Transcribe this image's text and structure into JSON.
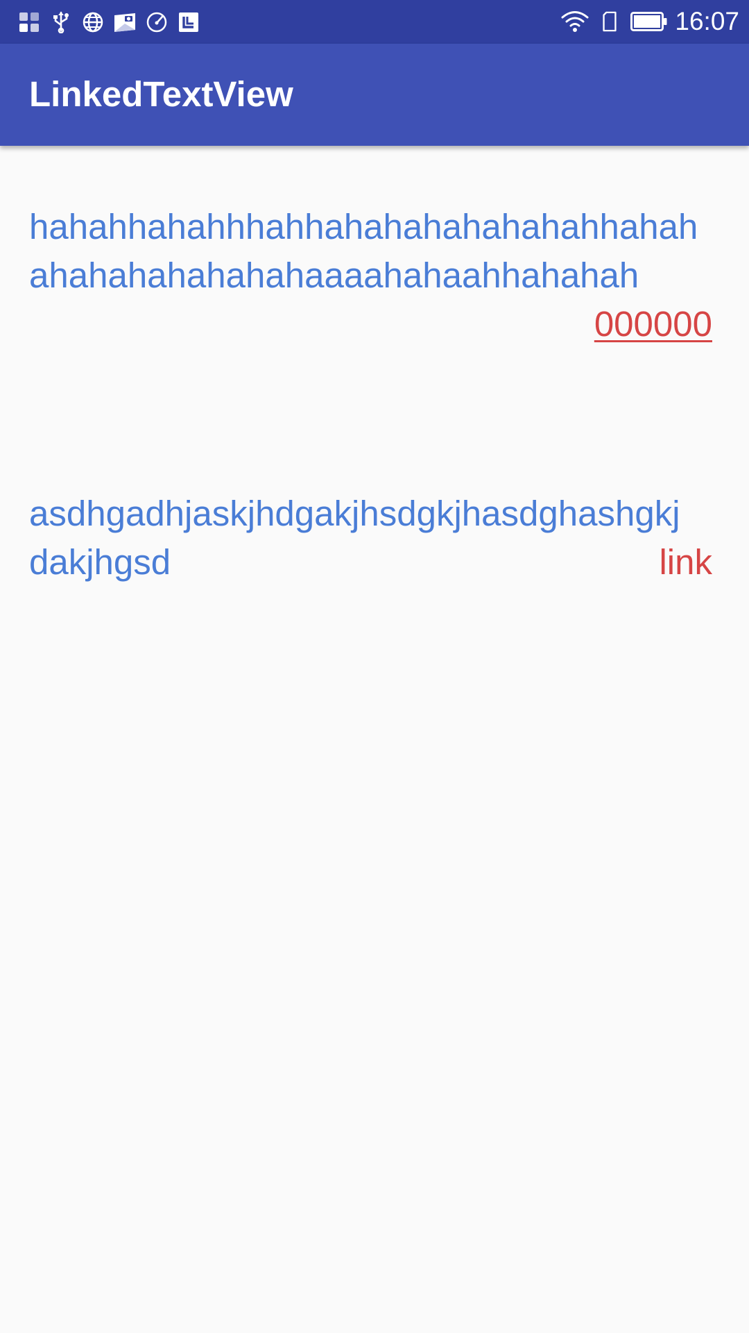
{
  "status_bar": {
    "time": "16:07",
    "left_icons": [
      "grid-icon",
      "usb-icon",
      "globe-icon",
      "photo-icon",
      "speed-icon",
      "calendar-icon"
    ],
    "right_icons": [
      "wifi-icon",
      "sim-icon",
      "battery-icon"
    ]
  },
  "app_bar": {
    "title": "LinkedTextView"
  },
  "text_view_1": {
    "line1": "hahahhahahhhahhahahahahahahahhahah",
    "line2": "ahahahahahahahaaaahahaahhahahah",
    "link_label": "000000"
  },
  "text_view_2": {
    "line1": "asdhgadhjaskjhdgakjhsdgkjhasdghashgkj",
    "line2": "dakjhgsd",
    "link_label": "link"
  },
  "colors": {
    "status_bar": "#303F9F",
    "app_bar": "#3F51B5",
    "text": "#4A7DD6",
    "link": "#D64545",
    "background": "#FAFAFA"
  }
}
